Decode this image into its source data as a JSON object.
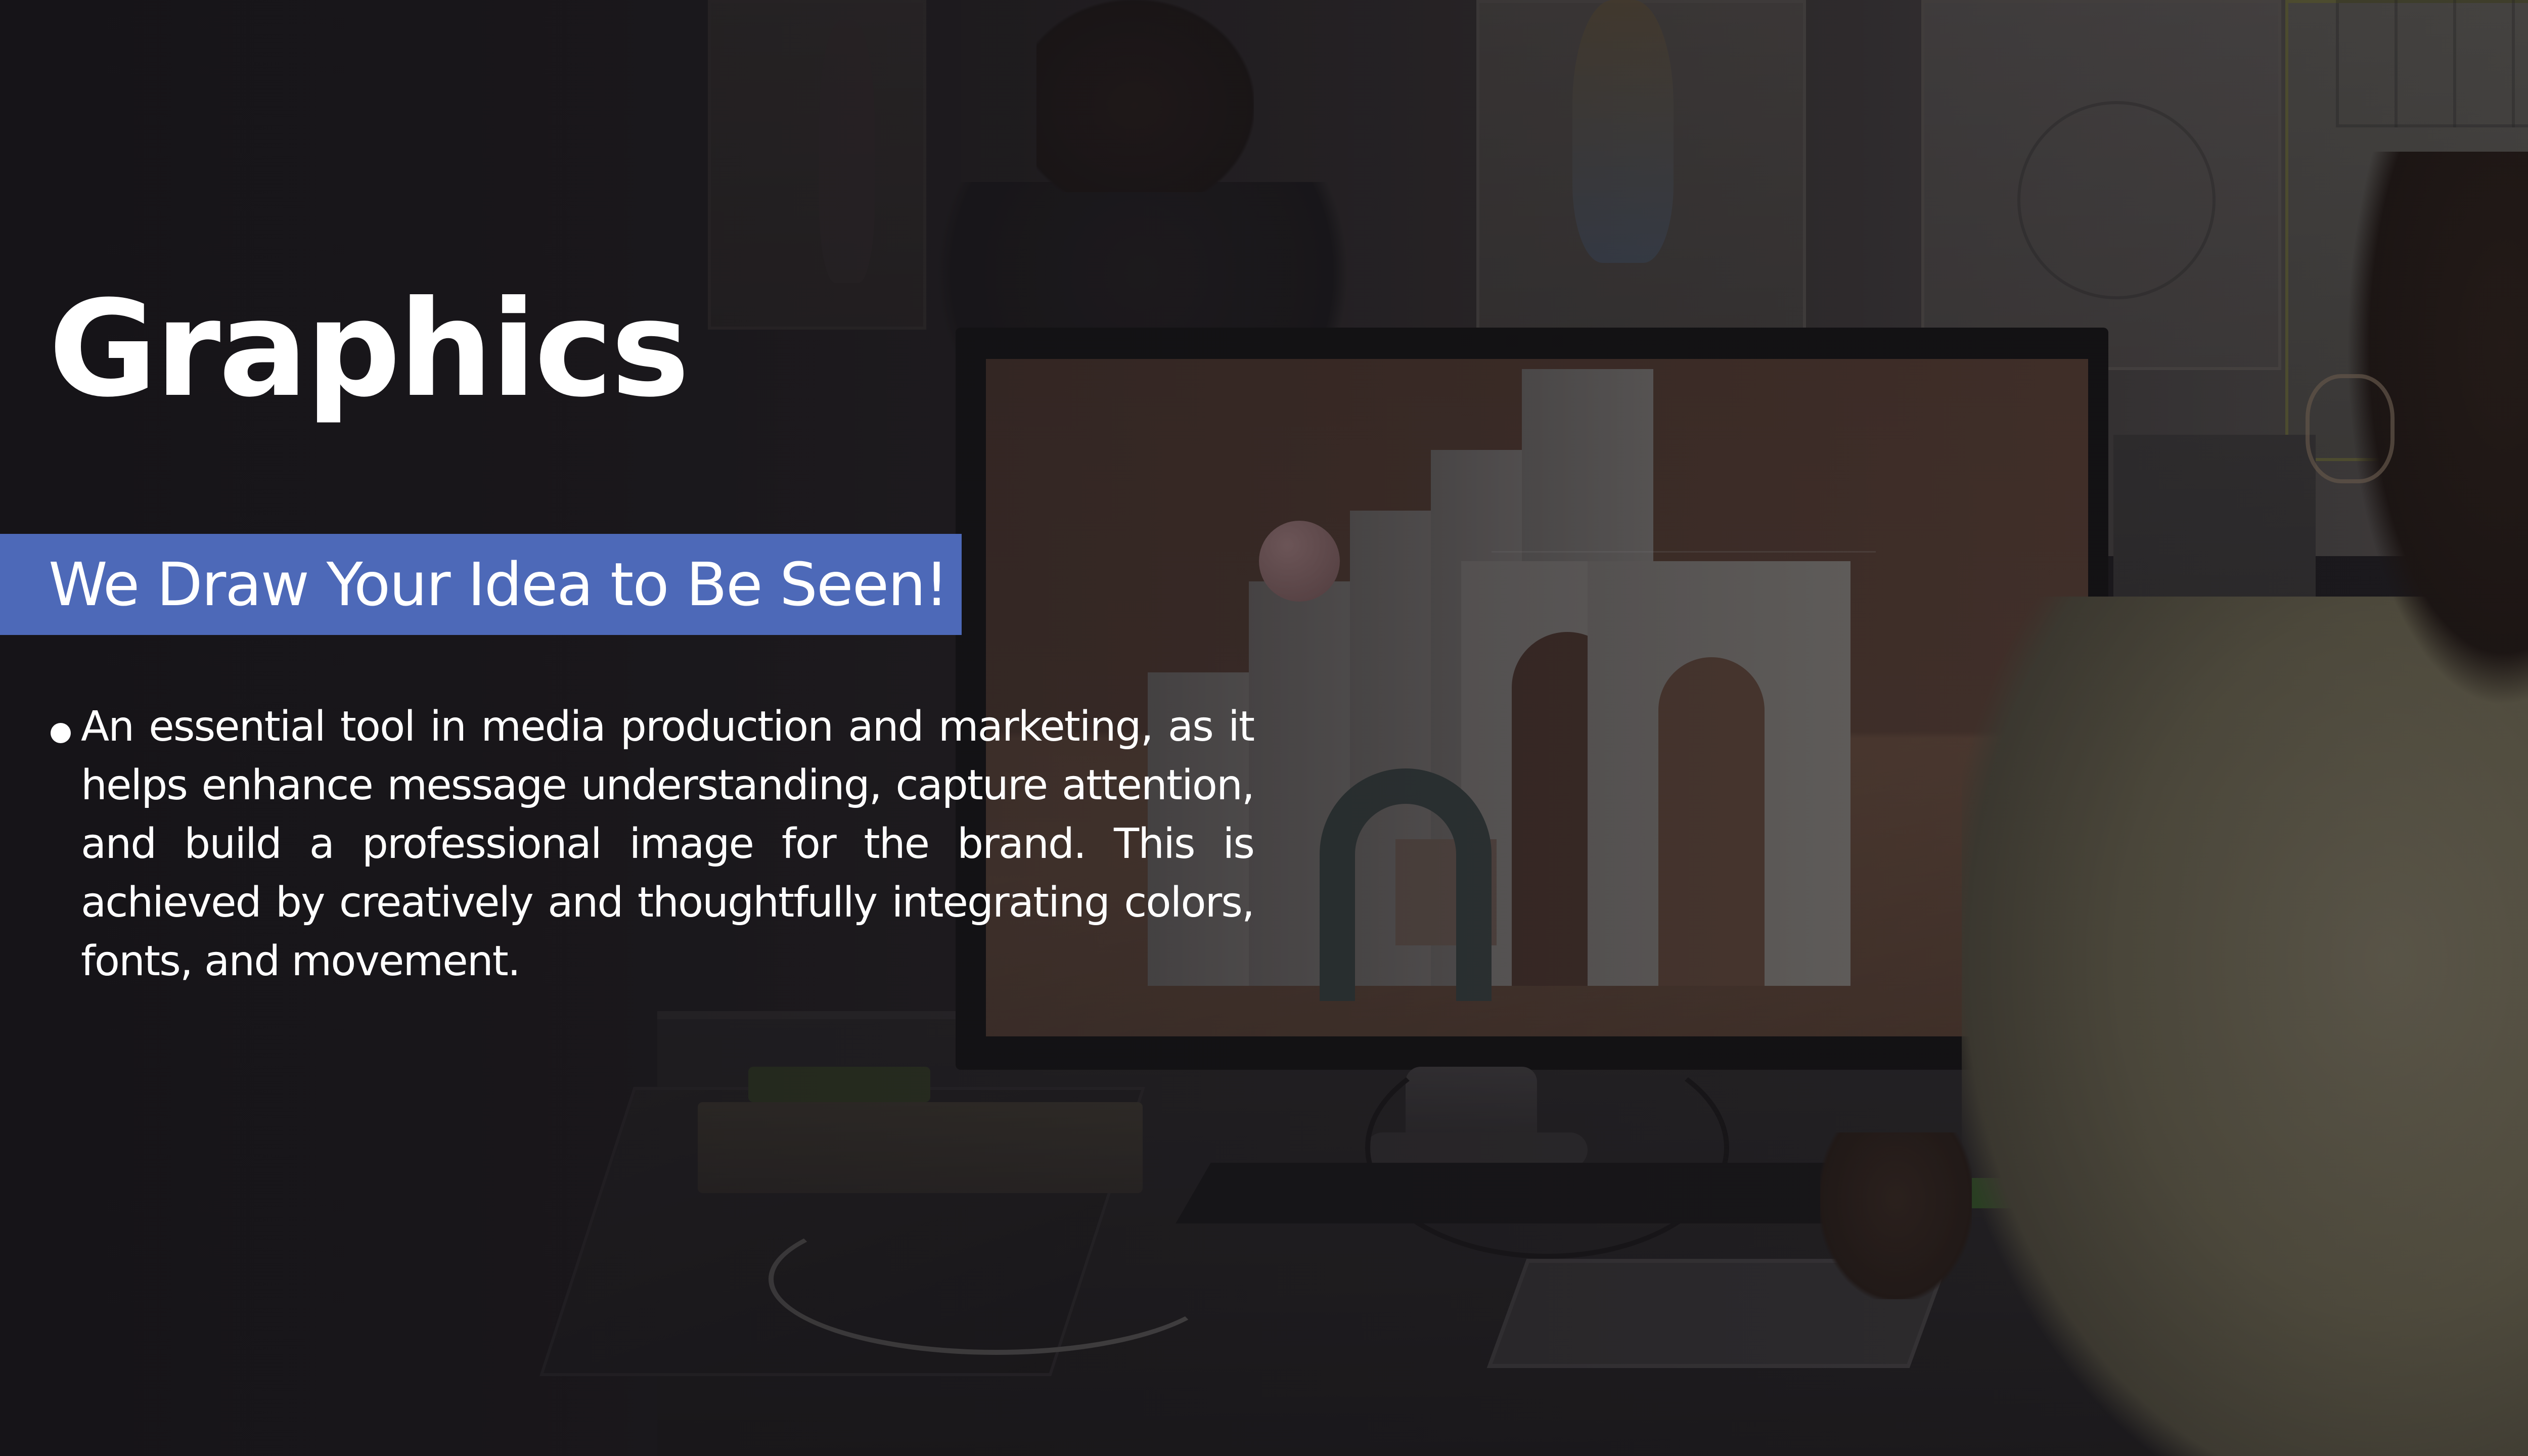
{
  "slide": {
    "title": "Graphics",
    "subtitle": "We Draw Your Idea to Be Seen!",
    "bullets": [
      "An essential tool in media production and marketing, as it helps enhance message understanding, capture attention, and build a professional image for the brand. This is achieved by creatively and thoughtfully integrating colors, fonts, and movement."
    ]
  },
  "colors": {
    "background": "#1e1c20",
    "title_text": "#ffffff",
    "subtitle_band": "#4d69b8",
    "body_text": "#ffffff"
  },
  "background_image": {
    "icon": "designer-at-monitor-photo"
  }
}
